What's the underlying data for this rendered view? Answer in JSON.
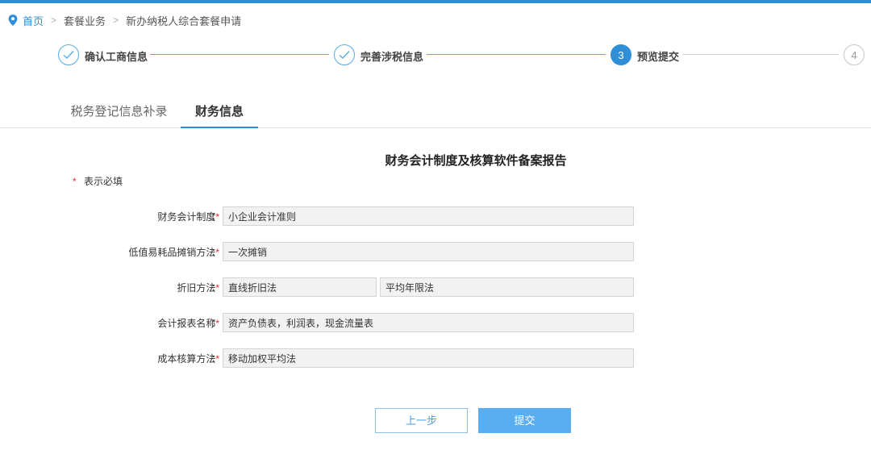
{
  "breadcrumb": {
    "home": "首页",
    "separator": ">",
    "crumb1": "套餐业务",
    "crumb2": "新办纳税人综合套餐申请"
  },
  "steps": [
    {
      "label": "确认工商信息",
      "state": "done"
    },
    {
      "label": "完善涉税信息",
      "state": "done"
    },
    {
      "number": "3",
      "label": "预览提交",
      "state": "active"
    },
    {
      "number": "4",
      "label": "",
      "state": "todo"
    }
  ],
  "tabs": [
    {
      "label": "税务登记信息补录",
      "active": false
    },
    {
      "label": "财务信息",
      "active": true
    }
  ],
  "form": {
    "title": "财务会计制度及核算软件备案报告",
    "required_star": "*",
    "required_note": "表示必填",
    "colon": "：",
    "rows": [
      {
        "label": "财务会计制度",
        "values": [
          "小企业会计准则"
        ]
      },
      {
        "label": "低值易耗品摊销方法",
        "values": [
          "一次摊销"
        ]
      },
      {
        "label": "折旧方法",
        "values": [
          "直线折旧法",
          "平均年限法"
        ]
      },
      {
        "label": "会计报表名称",
        "values": [
          "资产负债表，利润表，现金流量表"
        ]
      },
      {
        "label": "成本核算方法",
        "values": [
          "移动加权平均法"
        ]
      }
    ]
  },
  "buttons": {
    "prev": "上一步",
    "submit": "提交"
  },
  "colors": {
    "accent": "#2e8ed8",
    "required": "#e02a2a",
    "submit_bg": "#5aaef0"
  },
  "icons": {
    "location": "location-pin-icon",
    "step_done": "check-icon"
  }
}
